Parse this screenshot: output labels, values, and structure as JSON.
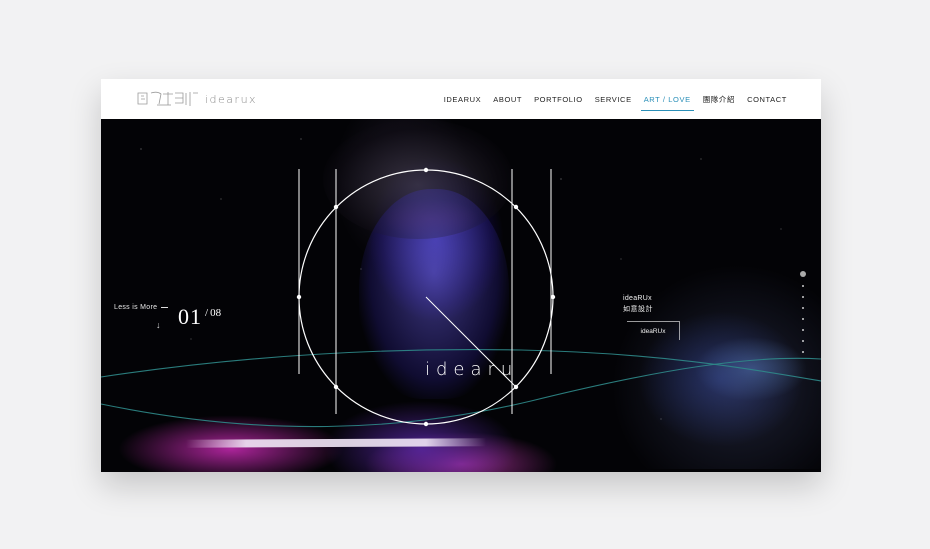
{
  "header": {
    "logo_word": "idearux",
    "nav": [
      {
        "label": "IDEARUX",
        "active": false
      },
      {
        "label": "ABOUT",
        "active": false
      },
      {
        "label": "PORTFOLIO",
        "active": false
      },
      {
        "label": "SERVICE",
        "active": false
      },
      {
        "label": "ART / LOVE",
        "active": true
      },
      {
        "label": "團隊介紹",
        "active": false
      },
      {
        "label": "CONTACT",
        "active": false
      }
    ]
  },
  "hero": {
    "tagline": "Less is More",
    "slide_current": "01",
    "slide_total": "08",
    "overlay_logo_text": "idearu",
    "brand_en": "ideaRUx",
    "brand_zh": "如意設計",
    "brand_button": "ideaRUx",
    "dots_count": 8,
    "active_dot": 1
  },
  "colors": {
    "accent": "#2a8fb8",
    "page_bg": "#f2f2f3",
    "hero_bg": "#030306"
  },
  "icons": [
    "logo-mark-icon",
    "down-arrow-icon"
  ]
}
